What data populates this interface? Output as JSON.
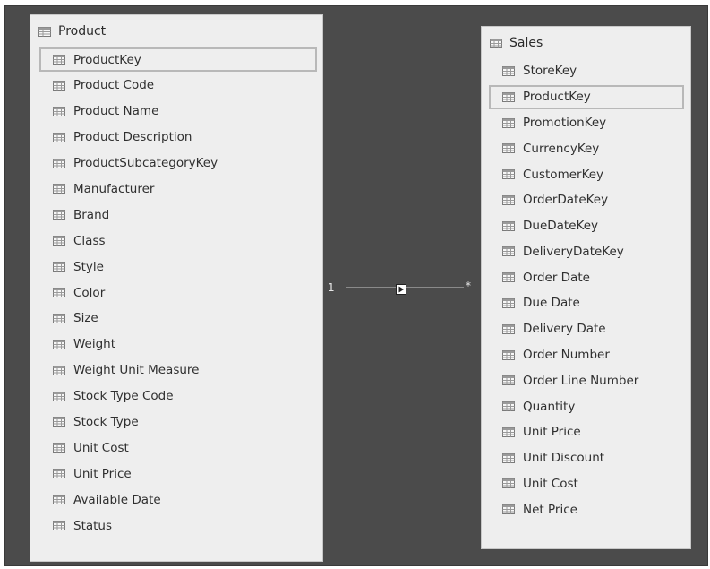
{
  "product_table": {
    "title": "Product",
    "fields": [
      {
        "label": "ProductKey",
        "selected": true
      },
      {
        "label": "Product Code"
      },
      {
        "label": "Product Name"
      },
      {
        "label": "Product Description"
      },
      {
        "label": "ProductSubcategoryKey"
      },
      {
        "label": "Manufacturer"
      },
      {
        "label": "Brand"
      },
      {
        "label": "Class"
      },
      {
        "label": "Style"
      },
      {
        "label": "Color"
      },
      {
        "label": "Size"
      },
      {
        "label": "Weight"
      },
      {
        "label": "Weight Unit Measure"
      },
      {
        "label": "Stock Type Code"
      },
      {
        "label": "Stock Type"
      },
      {
        "label": "Unit Cost"
      },
      {
        "label": "Unit Price"
      },
      {
        "label": "Available Date"
      },
      {
        "label": "Status"
      }
    ]
  },
  "sales_table": {
    "title": "Sales",
    "fields": [
      {
        "label": "StoreKey"
      },
      {
        "label": "ProductKey",
        "selected": true
      },
      {
        "label": "PromotionKey"
      },
      {
        "label": "CurrencyKey"
      },
      {
        "label": "CustomerKey"
      },
      {
        "label": "OrderDateKey"
      },
      {
        "label": "DueDateKey"
      },
      {
        "label": "DeliveryDateKey"
      },
      {
        "label": "Order Date"
      },
      {
        "label": "Due Date"
      },
      {
        "label": "Delivery Date"
      },
      {
        "label": "Order Number"
      },
      {
        "label": "Order Line Number"
      },
      {
        "label": "Quantity"
      },
      {
        "label": "Unit Price"
      },
      {
        "label": "Unit Discount"
      },
      {
        "label": "Unit Cost"
      },
      {
        "label": "Net Price"
      }
    ]
  },
  "relationship": {
    "one_side": "1",
    "many_side": "*"
  },
  "icons": {
    "table": "table-icon",
    "column": "column-icon"
  },
  "colors": {
    "canvas": "#4b4b4b",
    "card": "#eeeeee",
    "selection_border": "#b8b8b8"
  }
}
